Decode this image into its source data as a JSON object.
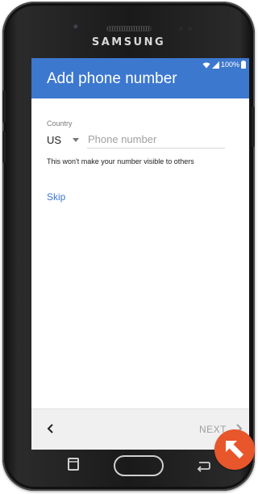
{
  "device": {
    "brand": "SAMSUNG"
  },
  "status_bar": {
    "battery_text": "100%"
  },
  "app_bar": {
    "title": "Add phone number",
    "color": "#3d78cf"
  },
  "form": {
    "country_label": "Country",
    "country_value": "US",
    "phone_placeholder": "Phone number",
    "phone_value": "",
    "privacy_note": "This won't make your number visible to others",
    "skip_label": "Skip"
  },
  "setup_nav": {
    "back_icon": "chevron-left-icon",
    "next_label": "NEXT",
    "next_icon": "chevron-right-icon"
  },
  "hardware_keys": {
    "recents_icon": "recents-icon",
    "home_icon": "home-button",
    "back_icon": "back-arrow-icon"
  },
  "overlay": {
    "icon": "up-left-arrow-icon",
    "color": "#e8562b"
  }
}
